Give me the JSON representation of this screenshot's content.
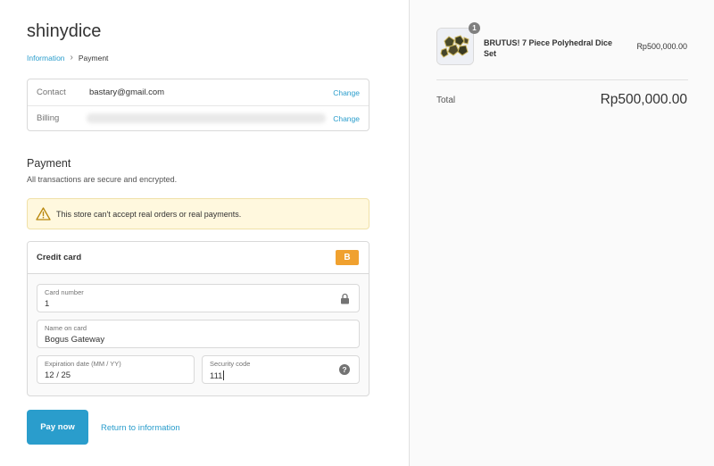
{
  "store": {
    "name": "shinydice"
  },
  "breadcrumb": {
    "information": "Information",
    "separator": "›",
    "payment": "Payment"
  },
  "review": {
    "contact_label": "Contact",
    "contact_value": "bastary@gmail.com",
    "billing_label": "Billing",
    "change_label": "Change"
  },
  "payment": {
    "title": "Payment",
    "subtitle": "All transactions are secure and encrypted.",
    "notice": "This store can't accept real orders or real payments."
  },
  "credit_card": {
    "title": "Credit card",
    "badge": "B",
    "card_number_label": "Card number",
    "card_number_value": "1",
    "name_label": "Name on card",
    "name_value": "Bogus Gateway",
    "expiry_label": "Expiration date (MM / YY)",
    "expiry_value": "12 / 25",
    "cvv_label": "Security code",
    "cvv_value": "111",
    "help_glyph": "?"
  },
  "actions": {
    "pay_now": "Pay now",
    "return": "Return to information"
  },
  "order": {
    "quantity": "1",
    "product_name": "BRUTUS! 7 Piece Polyhedral Dice Set",
    "product_price": "Rp500,000.00",
    "total_label": "Total",
    "total_value": "Rp500,000.00"
  },
  "colors": {
    "accent": "#2a9dcc",
    "badge": "#f0a12f",
    "notice_bg": "#fff8de"
  },
  "icons": {
    "warning": "warning-triangle-icon",
    "lock": "lock-icon",
    "help": "help-circle-icon"
  }
}
